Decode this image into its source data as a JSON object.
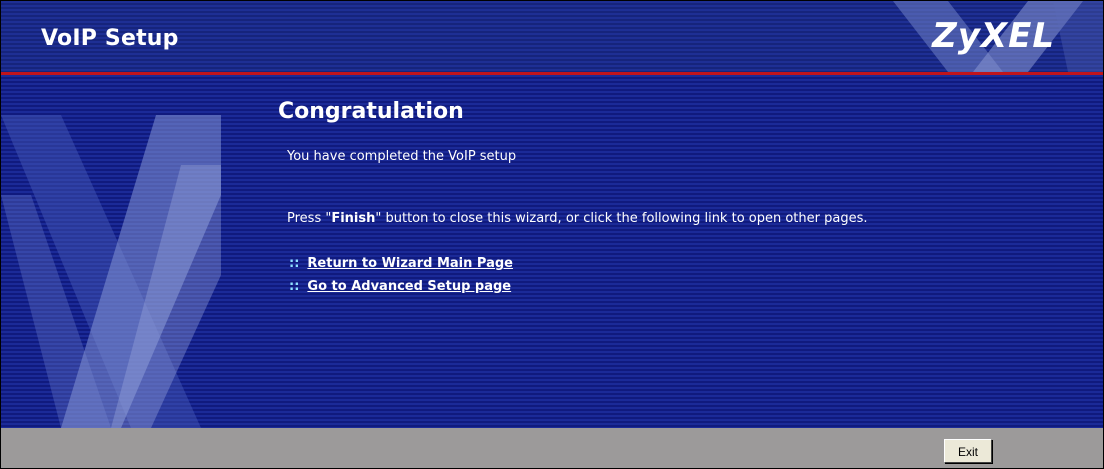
{
  "window": {
    "title": "VoIP Setup",
    "logo": "ZyXEL"
  },
  "main": {
    "heading": "Congratulation",
    "completed_text": "You have completed the VoIP setup",
    "instruction_prefix": "Press \"",
    "instruction_bold": "Finish",
    "instruction_suffix": "\" button to close this wizard, or click the following link to open other pages.",
    "links": [
      {
        "bullet": "::",
        "label": "Return to Wizard Main Page"
      },
      {
        "bullet": "::",
        "label": "Go to Advanced Setup page"
      }
    ]
  },
  "footer": {
    "exit_label": "Exit"
  },
  "colors": {
    "header_bg": "#1a2a8a",
    "main_bg": "#14208a",
    "accent_red": "#c0141c",
    "footer_bg": "#9c9a9a",
    "link_bullet": "#8fe0ff"
  }
}
